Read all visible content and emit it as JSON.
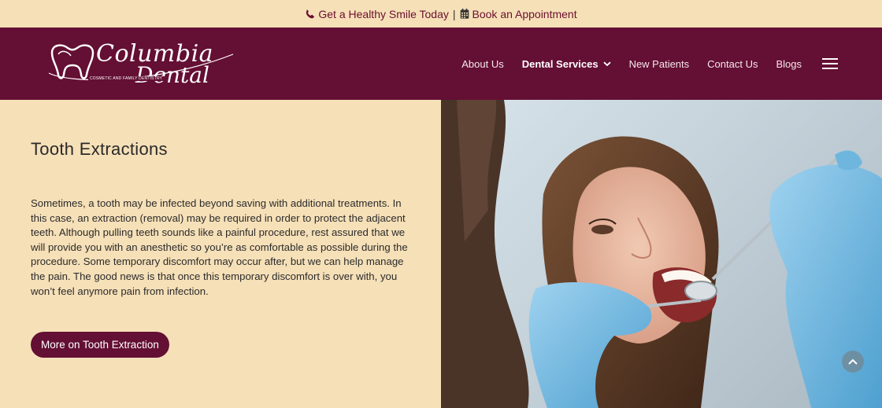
{
  "topbar": {
    "smile_label": "Get a Healthy Smile Today",
    "separator": "|",
    "appointment_label": "Book an Appointment",
    "phone_icon": "phone-icon",
    "calendar_icon": "calendar-icon"
  },
  "logo": {
    "name_line1": "Columbia",
    "name_line2": "Dental",
    "tagline": "COSMETIC AND FAMILY DENTISTRY"
  },
  "nav": {
    "items": [
      {
        "label": "About Us"
      },
      {
        "label": "Dental Services"
      },
      {
        "label": "New Patients"
      },
      {
        "label": "Contact Us"
      },
      {
        "label": "Blogs"
      }
    ],
    "menu_icon": "hamburger-icon"
  },
  "main": {
    "title": "Tooth Extractions",
    "body": "Sometimes, a tooth may be infected beyond saving with additional treatments. In this case, an extraction (removal) may be required in order to protect the adjacent teeth. Although pulling teeth sounds like a painful procedure, rest assured that we will provide you with an anesthetic so you’re as comfortable as possible during the procedure. Some temporary discomfort may occur after, but we can help manage the pain. The good news is that once this temporary discomfort is over with, you won’t feel anymore pain from infection.",
    "cta_label": "More on Tooth Extraction"
  },
  "colors": {
    "brand": "#640f34",
    "background": "#f6e0b8",
    "text": "#2b2b2b"
  }
}
